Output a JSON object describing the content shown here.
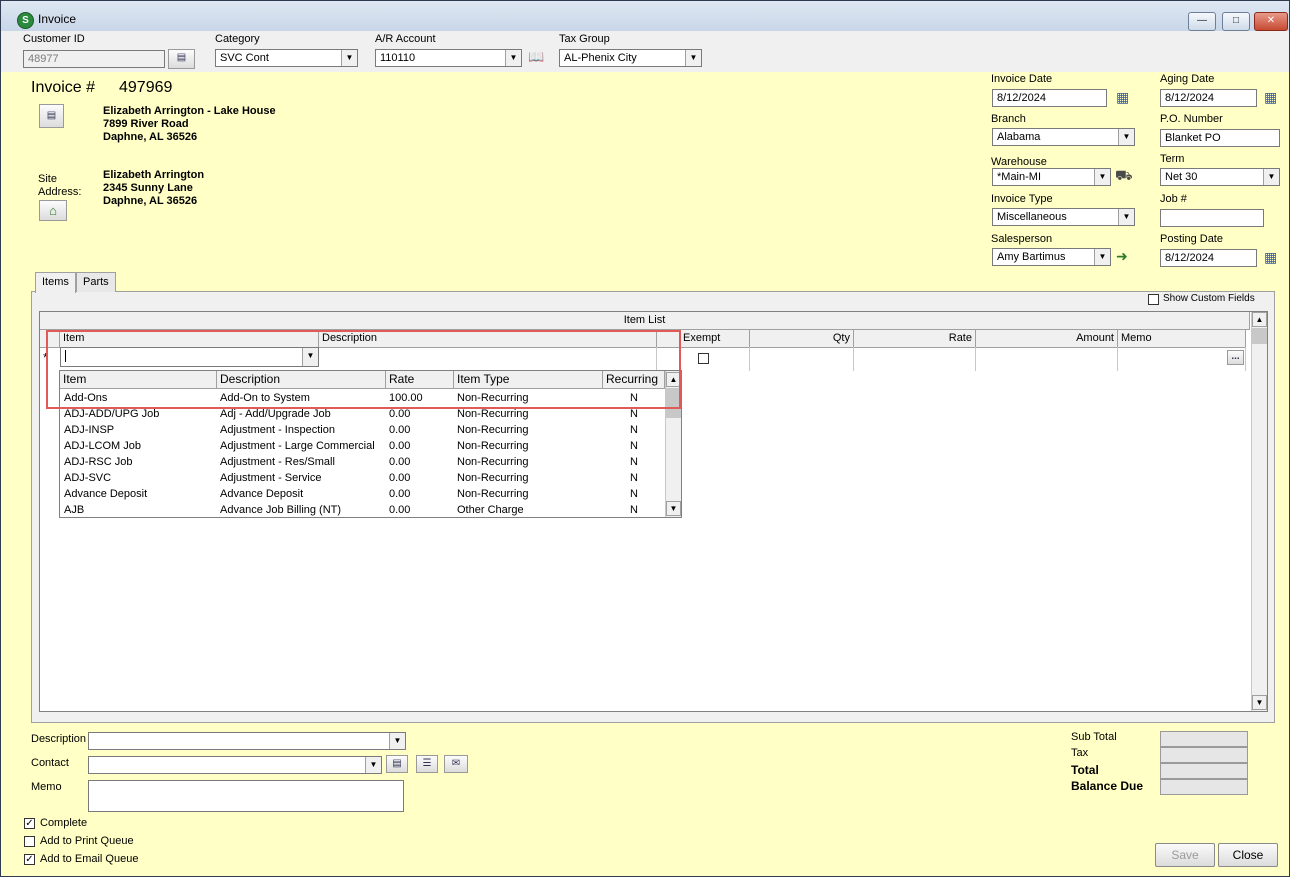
{
  "window": {
    "title": "Invoice",
    "app_icon": "S"
  },
  "top": {
    "customer_id": {
      "label": "Customer ID",
      "value": "48977"
    },
    "category": {
      "label": "Category",
      "value": "SVC Cont"
    },
    "ar_account": {
      "label": "A/R Account",
      "value": "110110"
    },
    "tax_group": {
      "label": "Tax Group",
      "value": "AL-Phenix City"
    }
  },
  "invoice": {
    "label": "Invoice #",
    "number": "497969",
    "bill_to": {
      "name": "Elizabeth Arrington - Lake House",
      "street": "7899 River Road",
      "city": "Daphne, AL  36526"
    },
    "site_label": "Site Address:",
    "site": {
      "name": "Elizabeth Arrington",
      "street": "2345 Sunny Lane",
      "city": "Daphne, AL  36526"
    }
  },
  "right": {
    "invoice_date": {
      "label": "Invoice Date",
      "value": "8/12/2024"
    },
    "aging_date": {
      "label": "Aging Date",
      "value": "8/12/2024"
    },
    "branch": {
      "label": "Branch",
      "value": "Alabama"
    },
    "po_number": {
      "label": "P.O. Number",
      "value": "Blanket PO"
    },
    "warehouse": {
      "label": "Warehouse",
      "value": "*Main-MI"
    },
    "term": {
      "label": "Term",
      "value": "Net 30"
    },
    "invoice_type": {
      "label": "Invoice Type",
      "value": "Miscellaneous"
    },
    "job": {
      "label": "Job #",
      "value": ""
    },
    "salesperson": {
      "label": "Salesperson",
      "value": "Amy Bartimus"
    },
    "posting_date": {
      "label": "Posting Date",
      "value": "8/12/2024"
    }
  },
  "tabs": [
    "Items",
    "Parts"
  ],
  "show_custom_fields": "Show Custom Fields",
  "grid": {
    "caption": "Item List",
    "columns": [
      "Item",
      "Description",
      "Exempt",
      "Qty",
      "Rate",
      "Amount",
      "Memo"
    ],
    "new_row_marker": "*",
    "memo_button": "..."
  },
  "item_dropdown": {
    "columns": [
      "Item",
      "Description",
      "Rate",
      "Item Type",
      "Recurring"
    ],
    "rows": [
      [
        "Add-Ons",
        "Add-On to System",
        "100.00",
        "Non-Recurring",
        "N"
      ],
      [
        "ADJ-ADD/UPG Job",
        "Adj - Add/Upgrade Job",
        "0.00",
        "Non-Recurring",
        "N"
      ],
      [
        "ADJ-INSP",
        "Adjustment - Inspection",
        "0.00",
        "Non-Recurring",
        "N"
      ],
      [
        "ADJ-LCOM Job",
        "Adjustment - Large Commercial",
        "0.00",
        "Non-Recurring",
        "N"
      ],
      [
        "ADJ-RSC Job",
        "Adjustment - Res/Small",
        "0.00",
        "Non-Recurring",
        "N"
      ],
      [
        "ADJ-SVC",
        "Adjustment - Service",
        "0.00",
        "Non-Recurring",
        "N"
      ],
      [
        "Advance Deposit",
        "Advance Deposit",
        "0.00",
        "Non-Recurring",
        "N"
      ],
      [
        "AJB",
        "Advance Job Billing (NT)",
        "0.00",
        "Other Charge",
        "N"
      ]
    ]
  },
  "bottom": {
    "description_label": "Description",
    "contact_label": "Contact",
    "memo_label": "Memo",
    "complete": "Complete",
    "add_print_queue": "Add to Print Queue",
    "add_email_queue": "Add to Email Queue",
    "complete_checked": true,
    "print_checked": false,
    "email_checked": true
  },
  "totals": {
    "sub_total": "Sub Total",
    "tax": "Tax",
    "total": "Total",
    "balance_due": "Balance Due"
  },
  "buttons": {
    "save": "Save",
    "close": "Close"
  }
}
